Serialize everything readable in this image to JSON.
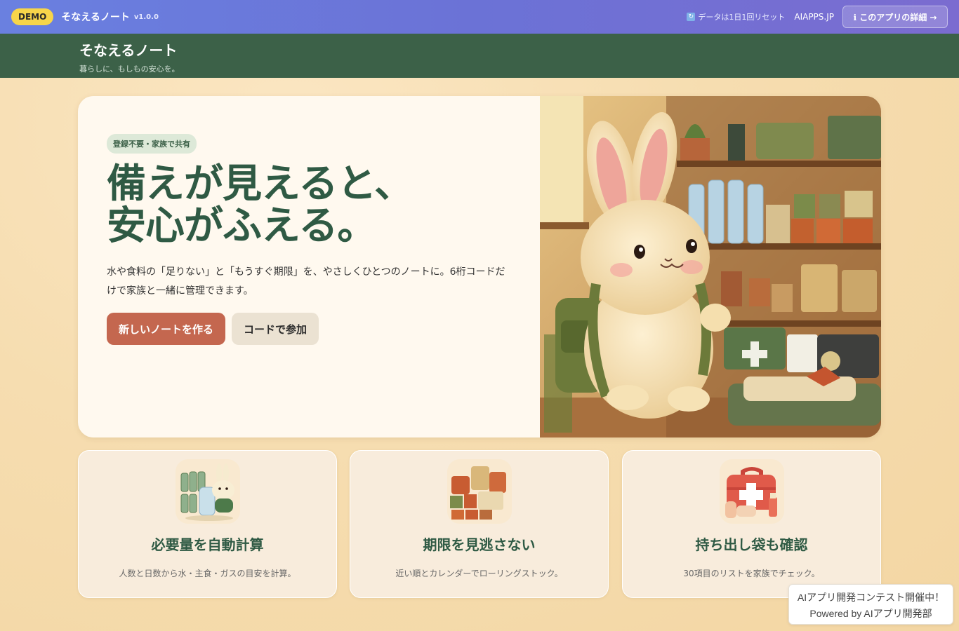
{
  "demo_bar": {
    "badge": "DEMO",
    "title": "そなえるノート",
    "version": "v1.0.0",
    "reset_icon": "refresh-icon",
    "reset_note": "データは1日1回リセット",
    "site_link": "AIAPPS.JP",
    "detail_button": "ℹ このアプリの詳細 →"
  },
  "header": {
    "app_name": "そなえるノート",
    "tagline": "暮らしに、もしもの安心を。"
  },
  "hero": {
    "chip": "登録不要・家族で共有",
    "heading_line1": "備えが見えると、",
    "heading_line2": "安心がふえる。",
    "description": "水や食料の「足りない」と「もうすぐ期限」を、やさしくひとつのノートに。6桁コードだけで家族と一緒に管理できます。",
    "primary_button": "新しいノートを作る",
    "secondary_button": "コードで参加"
  },
  "features": [
    {
      "icon": "water-bottles-rabbit-icon",
      "title": "必要量を自動計算",
      "desc": "人数と日数から水・主食・ガスの目安を計算。"
    },
    {
      "icon": "canned-food-icon",
      "title": "期限を見逃さない",
      "desc": "近い順とカレンダーでローリングストック。"
    },
    {
      "icon": "first-aid-kit-icon",
      "title": "持ち出し袋も確認",
      "desc": "30項目のリストを家族でチェック。"
    }
  ],
  "contest": {
    "line1": "AIアプリ開発コンテスト開催中！",
    "line2": "Powered by AIアプリ開発部"
  },
  "colors": {
    "brand_green": "#3c6148",
    "accent_terracotta": "#c4674f",
    "demo_gradient_start": "#6a80e0",
    "demo_badge": "#f7d54a"
  }
}
